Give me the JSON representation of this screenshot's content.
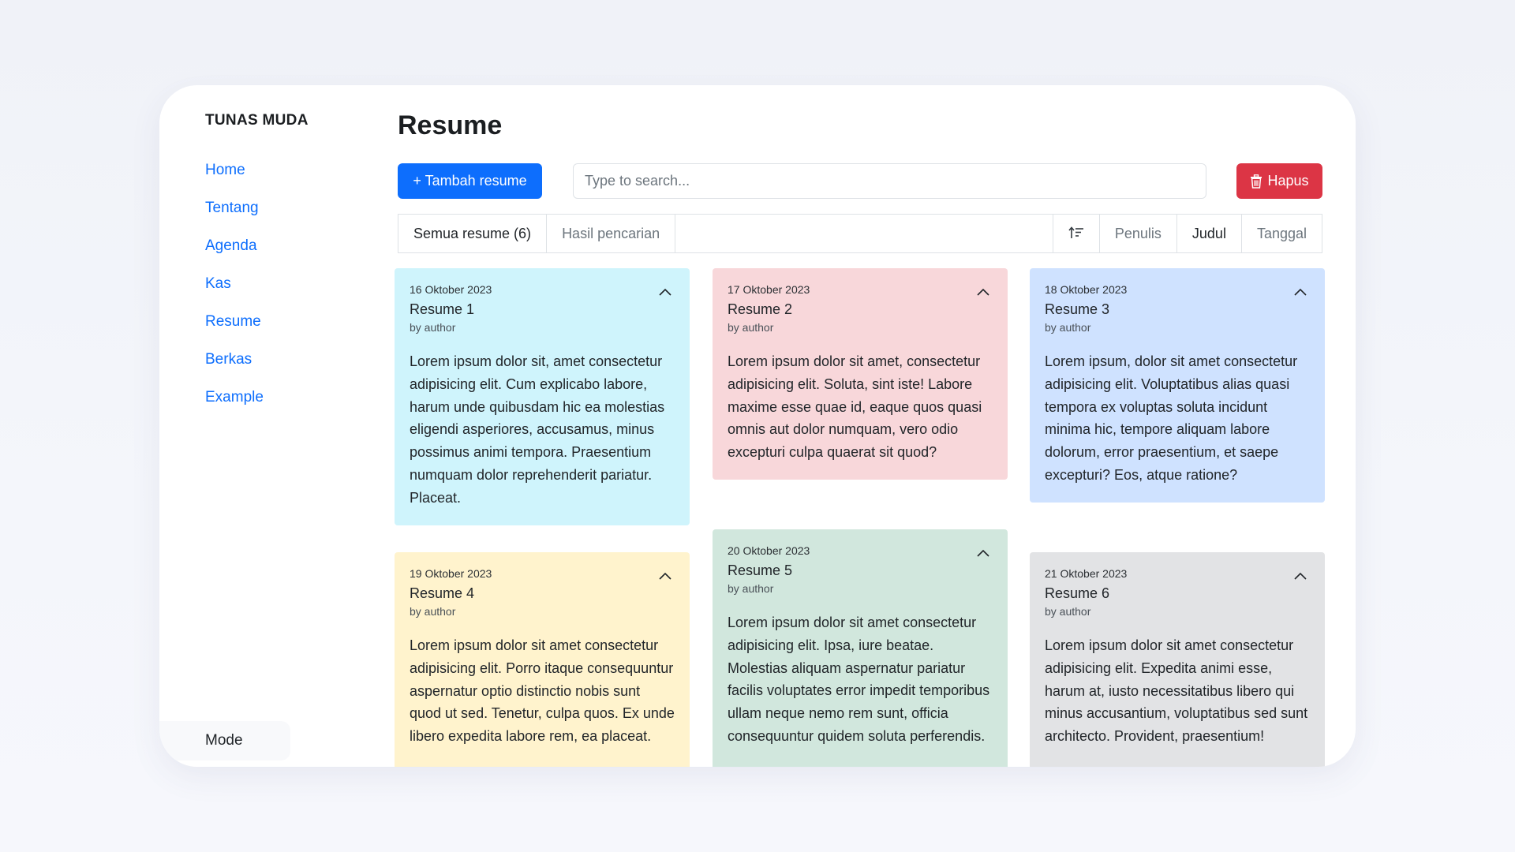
{
  "brand": "TUNAS MUDA",
  "nav": [
    "Home",
    "Tentang",
    "Agenda",
    "Kas",
    "Resume",
    "Berkas",
    "Example"
  ],
  "mode_label": "Mode",
  "page_title": "Resume",
  "add_button": "+ Tambah resume",
  "search": {
    "placeholder": "Type to search...",
    "value": ""
  },
  "delete_button": "Hapus",
  "filter": {
    "tabs": [
      "Semua resume (6)",
      "Hasil pencarian"
    ],
    "sort_icon": "sort-icon",
    "sort_options": [
      "Penulis",
      "Judul",
      "Tanggal"
    ],
    "active_sort": "Judul"
  },
  "colors": {
    "primary": "#0d6efd",
    "danger": "#dc3545",
    "card_cyan": "#cff4fc",
    "card_red": "#f8d7da",
    "card_blue": "#cfe2ff",
    "card_yellow": "#fff3cd",
    "card_green": "#d1e7dd",
    "card_gray": "#e2e3e5"
  },
  "cards": [
    {
      "date": "16 Oktober 2023",
      "title": "Resume 1",
      "author": "by author",
      "body": "Lorem ipsum dolor sit, amet consectetur adipisicing elit. Cum explicabo labore, harum unde quibusdam hic ea molestias eligendi asperiores, accusamus, minus possimus animi tempora. Praesentium numquam dolor reprehenderit pariatur. Placeat."
    },
    {
      "date": "17 Oktober 2023",
      "title": "Resume 2",
      "author": "by author",
      "body": "Lorem ipsum dolor sit amet, consectetur adipisicing elit. Soluta, sint iste! Labore maxime esse quae id, eaque quos quasi omnis aut dolor numquam, vero odio excepturi culpa quaerat sit quod?"
    },
    {
      "date": "18 Oktober 2023",
      "title": "Resume 3",
      "author": "by author",
      "body": "Lorem ipsum, dolor sit amet consectetur adipisicing elit. Voluptatibus alias quasi tempora ex voluptas soluta incidunt minima hic, tempore aliquam labore dolorum, error praesentium, et saepe excepturi? Eos, atque ratione?"
    },
    {
      "date": "19 Oktober 2023",
      "title": "Resume 4",
      "author": "by author",
      "body": "Lorem ipsum dolor sit amet consectetur adipisicing elit. Porro itaque consequuntur aspernatur optio distinctio nobis sunt quod ut sed. Tenetur, culpa quos. Ex unde libero expedita labore rem, ea placeat."
    },
    {
      "date": "20 Oktober 2023",
      "title": "Resume 5",
      "author": "by author",
      "body": "Lorem ipsum dolor sit amet consectetur adipisicing elit. Ipsa, iure beatae. Molestias aliquam aspernatur pariatur facilis voluptates error impedit temporibus ullam neque nemo rem sunt, officia consequuntur quidem soluta perferendis."
    },
    {
      "date": "21 Oktober 2023",
      "title": "Resume 6",
      "author": "by author",
      "body": "Lorem ipsum dolor sit amet consectetur adipisicing elit. Expedita animi esse, harum at, iusto necessitatibus libero qui minus accusantium, voluptatibus sed sunt architecto. Provident, praesentium!"
    }
  ]
}
